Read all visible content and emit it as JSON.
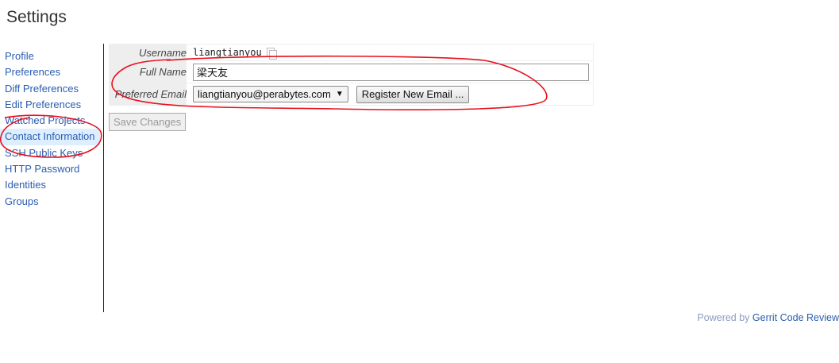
{
  "page": {
    "title": "Settings"
  },
  "sidebar": {
    "items": [
      {
        "label": "Profile"
      },
      {
        "label": "Preferences"
      },
      {
        "label": "Diff Preferences"
      },
      {
        "label": "Edit Preferences"
      },
      {
        "label": "Watched Projects"
      },
      {
        "label": "Contact Information"
      },
      {
        "label": "SSH Public Keys"
      },
      {
        "label": "HTTP Password"
      },
      {
        "label": "Identities"
      },
      {
        "label": "Groups"
      }
    ],
    "active_item": "Contact Information"
  },
  "contact_form": {
    "username_label": "Username",
    "username_value": "liangtianyou",
    "copy_icon": "copy-icon",
    "fullname_label": "Full Name",
    "fullname_value": "梁天友",
    "email_label": "Preferred Email",
    "email_selected": "liangtianyou@perabytes.com",
    "email_arrow": "▼",
    "register_label": "Register New Email ..."
  },
  "actions": {
    "save_label": "Save Changes"
  },
  "footer": {
    "prefix": "Powered by",
    "link_text": "Gerrit Code Review"
  },
  "annotations": {
    "color": "#e8101e"
  }
}
